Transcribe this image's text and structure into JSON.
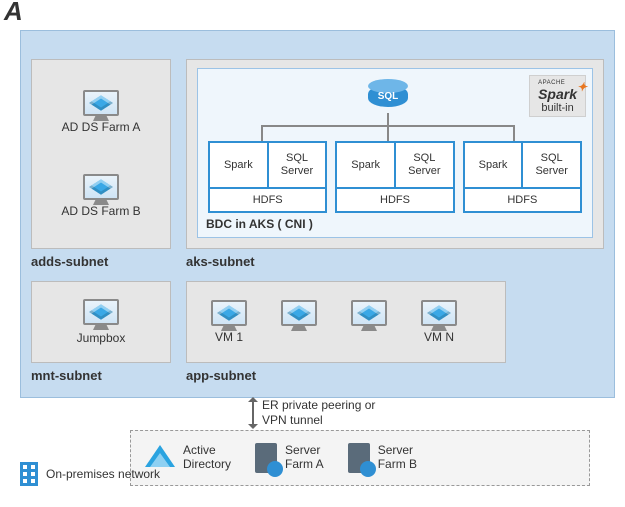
{
  "logo_text": "A",
  "adds": {
    "label": "adds-subnet",
    "farm_a": "AD DS Farm A",
    "farm_b": "AD DS Farm B"
  },
  "aks": {
    "label": "aks-subnet",
    "bdc_title": "BDC in AKS ( CNI )",
    "spark_apache": "APACHE",
    "spark_word": "Spark",
    "spark_sub": "built-in",
    "sql_cyl": "SQL",
    "node": {
      "spark": "Spark",
      "sqlserver": "SQL\nServer",
      "hdfs": "HDFS"
    }
  },
  "mnt": {
    "label": "mnt-subnet",
    "jumpbox": "Jumpbox"
  },
  "app": {
    "label": "app-subnet",
    "vm1": "VM 1",
    "vmn": "VM N"
  },
  "connection": "ER private peering or\nVPN tunnel",
  "onprem": {
    "title": "On-premises network",
    "ad": "Active\nDirectory",
    "farm_a": "Server\nFarm A",
    "farm_b": "Server\nFarm B"
  }
}
